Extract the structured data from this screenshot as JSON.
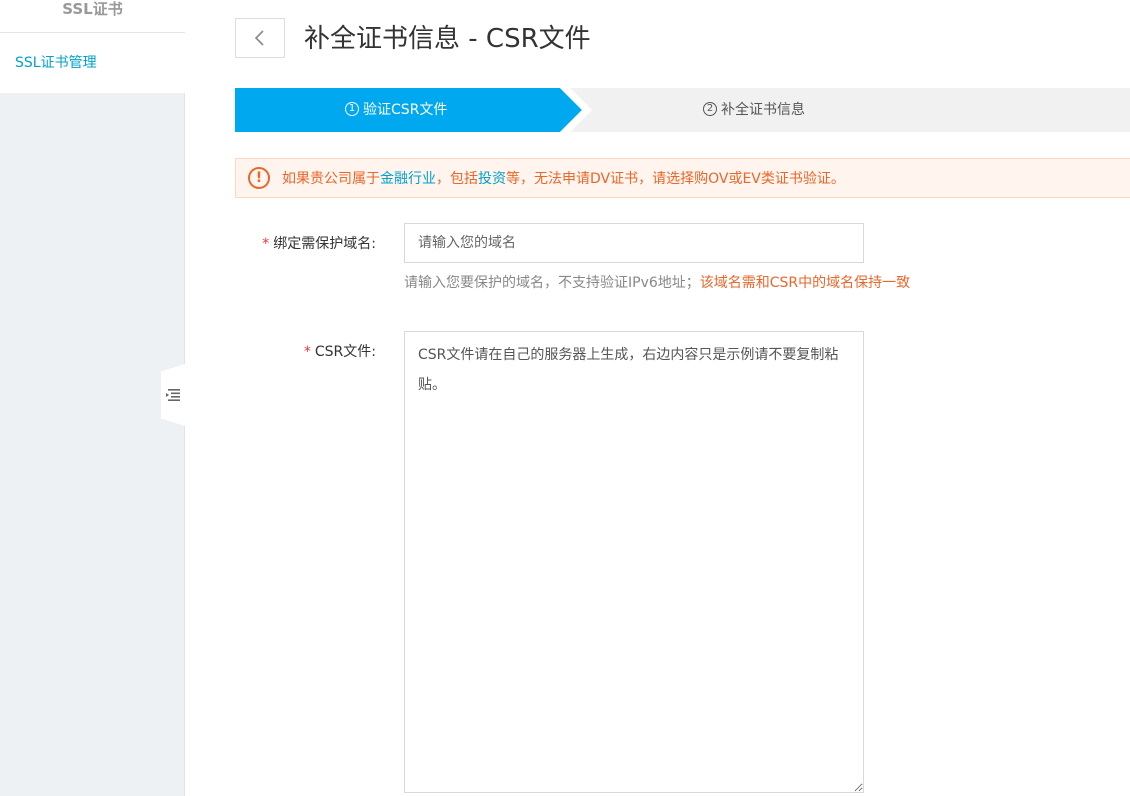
{
  "sidebar": {
    "title": "SSL证书",
    "items": [
      {
        "label": "SSL证书管理"
      }
    ]
  },
  "header": {
    "title": "补全证书信息 - CSR文件"
  },
  "steps": [
    {
      "number": "1",
      "label": "验证CSR文件",
      "active": true
    },
    {
      "number": "2",
      "label": "补全证书信息",
      "active": false
    }
  ],
  "alert": {
    "text_1": "如果贵公司属于",
    "link_1": "金融行业",
    "text_2": "，包括",
    "link_2": "投资",
    "text_3": "等，无法申请DV证书，请选择购OV或EV类证书验证。"
  },
  "form": {
    "domain": {
      "required_mark": "*",
      "label": "绑定需保护域名:",
      "placeholder": "请输入您的域名",
      "value": "",
      "hint": "请输入您要保护的域名，不支持验证IPv6地址；",
      "hint_warning": "该域名需和CSR中的域名保持一致"
    },
    "csr": {
      "required_mark": "*",
      "label": "CSR文件:",
      "placeholder": "CSR文件请在自己的服务器上生成，右边内容只是示例请不要复制粘贴。",
      "value": ""
    }
  },
  "colors": {
    "accent": "#00a2ca",
    "step_active": "#00a8f0",
    "step_inactive": "#f1f1f1",
    "warning": "#e8672a",
    "required": "#ee3333"
  }
}
